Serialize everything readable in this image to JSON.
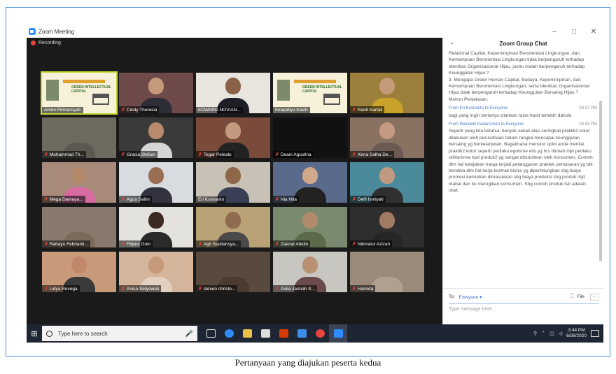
{
  "window": {
    "title": "Zoom Meeting",
    "minimize": "–",
    "maximize": "□",
    "close": "✕"
  },
  "recording": "Recording",
  "slide": {
    "title": "GREEN INTELLECTUAL CAPITAL"
  },
  "participants": [
    {
      "name": "Amrie Firmansyah",
      "muted": false,
      "kind": "slide",
      "active": true
    },
    {
      "name": "Cindy Theresia",
      "muted": true,
      "kind": "person",
      "bg": "#6e4a4a",
      "face": "#c49a7a",
      "cloth": "#2d2d38"
    },
    {
      "name": "EDWARD NOVIAN...",
      "muted": false,
      "kind": "person",
      "bg": "#e8e4de",
      "face": "#8a6248",
      "cloth": "#1e1e26"
    },
    {
      "name": "Ekayahyu Kasih",
      "muted": false,
      "kind": "slide"
    },
    {
      "name": "Ranti Kartali",
      "muted": true,
      "kind": "person",
      "bg": "#9c7f3a",
      "face": "#c59a7a",
      "cloth": "#c8a22a"
    },
    {
      "name": "Muhammad Th...",
      "muted": true,
      "kind": "person",
      "bg": "#6d6a60",
      "face": "#6d6a60",
      "cloth": "#5b5950"
    },
    {
      "name": "Gracia Stefani",
      "muted": true,
      "kind": "person",
      "bg": "#3a3a3a",
      "face": "#b98a6e",
      "cloth": "#d6d6d6"
    },
    {
      "name": "Tegar Pelealu",
      "muted": true,
      "kind": "person",
      "bg": "#7a4a3a",
      "face": "#c39a80",
      "cloth": "#222"
    },
    {
      "name": "Deani Agustina",
      "muted": true,
      "kind": "person",
      "bg": "#111111",
      "face": "#111",
      "cloth": "#111"
    },
    {
      "name": "Xena Salha De...",
      "muted": true,
      "kind": "person",
      "bg": "#8a7262",
      "face": "#c49a82",
      "cloth": "#6a5a52"
    },
    {
      "name": "Mega Damaya...",
      "muted": true,
      "kind": "person",
      "bg": "#a88a7a",
      "face": "#b48a6a",
      "cloth": "#d86aa2"
    },
    {
      "name": "Agus Salim",
      "muted": true,
      "kind": "person",
      "bg": "#d8dce0",
      "face": "#9a6e52",
      "cloth": "#33333f"
    },
    {
      "name": "Eri Kusnanto",
      "muted": false,
      "kind": "person",
      "bg": "#c8c2b6",
      "face": "#8e6648",
      "cloth": "#3a3f56"
    },
    {
      "name": "Nia Nita",
      "muted": true,
      "kind": "person",
      "bg": "#5a6a8a",
      "face": "#d2a88a",
      "cloth": "#222"
    },
    {
      "name": "Delfi Ismiyati",
      "muted": true,
      "kind": "person",
      "bg": "#4a8a9a",
      "face": "#c09a80",
      "cloth": "#303030"
    },
    {
      "name": "Rahayu Febrianti...",
      "muted": true,
      "kind": "person",
      "bg": "#8a7a6e",
      "face": "#8a7a6e",
      "cloth": "#7a6a5a"
    },
    {
      "name": "Filipus Gulo",
      "muted": true,
      "kind": "person",
      "bg": "#e4e2dc",
      "face": "#3a2a22",
      "cloth": "#2a2a2a"
    },
    {
      "name": "Agil Septiansya...",
      "muted": true,
      "kind": "person",
      "bg": "#b8a276",
      "face": "#8e6a4e",
      "cloth": "#4a4a4a"
    },
    {
      "name": "Zaenal Abidin",
      "muted": true,
      "kind": "person",
      "bg": "#7a8a6e",
      "face": "#b08a6a",
      "cloth": "#5a6a4a"
    },
    {
      "name": "Nikmatul Azizah",
      "muted": true,
      "kind": "person",
      "bg": "#2e2e2e",
      "face": "#a07a62",
      "cloth": "#262626"
    },
    {
      "name": "Lidya Revega",
      "muted": true,
      "kind": "person",
      "bg": "#c89a7a",
      "face": "#c08a6a",
      "cloth": "#3a3a3a"
    },
    {
      "name": "Anisa Setyowati",
      "muted": true,
      "kind": "person",
      "bg": "#d4b49a",
      "face": "#c69a7a",
      "cloth": "#e2d0c0"
    },
    {
      "name": "steven christe...",
      "muted": true,
      "kind": "person",
      "bg": "#5a4a3e",
      "face": "#5a4a3e",
      "cloth": "#4a3a30"
    },
    {
      "name": "Aulia Jannah S...",
      "muted": true,
      "kind": "person",
      "bg": "#c8c6c0",
      "face": "#b89072",
      "cloth": "#6a4a4a"
    },
    {
      "name": "Hamida",
      "muted": true,
      "kind": "person",
      "bg": "#9a8a7a",
      "face": "#9a8a7a",
      "cloth": "#b0a090"
    }
  ],
  "chat": {
    "title": "Zoom Group Chat",
    "intro": "Relational Capital, Kepemimpinan Berorientasi Lingkungan, dan Kemampuan Berorientasi Lingkungan tidak berpengaruh terhadap Identitas Organisasional Hijau, justru malah berpengaruh terhadap Keunggulan Hijau  ?\n3. Mengapa Green Human Capital, Budaya, Kepemimpinan, dan Kemampuan Berorientasi Lingkungan, serta Identitas Organisasional Hijau tidak berpengaruh terhadap Keunggulan Bersaing Hijau  ?\nMohon Penjelasan.",
    "messages": [
      {
        "from": "From Eri Kusnanto to Everyone:",
        "time": "03:37 PM",
        "text": "bagi yang ingin bertanya silahkan raise hand terlebih dahulu"
      },
      {
        "from": "From Reinaldo Kadarisman to Everyone:",
        "time": "03:43 PM",
        "text": "Seperti yang kita ketahui, banyak sekali atau seringkali praktik2 kotor dilakukan oleh perusahaan dalam rangka mencapai keunggulan bersaing yg berkelanjutan. Bagaimana menurut opini anda menilai praktik2 kotor seperti perilaku egoisme etis yg hrs diubah mjd perilaku utilitarisme kpd produk2 yg sangat dibutuhkan oleh konsumen. Contoh: dlm hal kebijakan harga terjadi pelanggaran praktek pemasaran yg tdk beretika dlm hal kerja kontrak bisnis yg diperhitungkan sbg biaya promosi kemudian dimasukkan sbg biaya produksi shg produk mjd mahal dan itu merugikan konsumen. Sbg contoh produk tsb adalah obat."
      }
    ],
    "to_label": "To:",
    "to_value": "Everyone ▾",
    "file_label": "File",
    "more_label": "···",
    "input_placeholder": "Type message here..."
  },
  "taskbar": {
    "search_placeholder": "Type here to search",
    "time": "3:44 PM",
    "date": "6/26/2020"
  },
  "caption": "Pertanyaan yang diajukan peserta kedua"
}
